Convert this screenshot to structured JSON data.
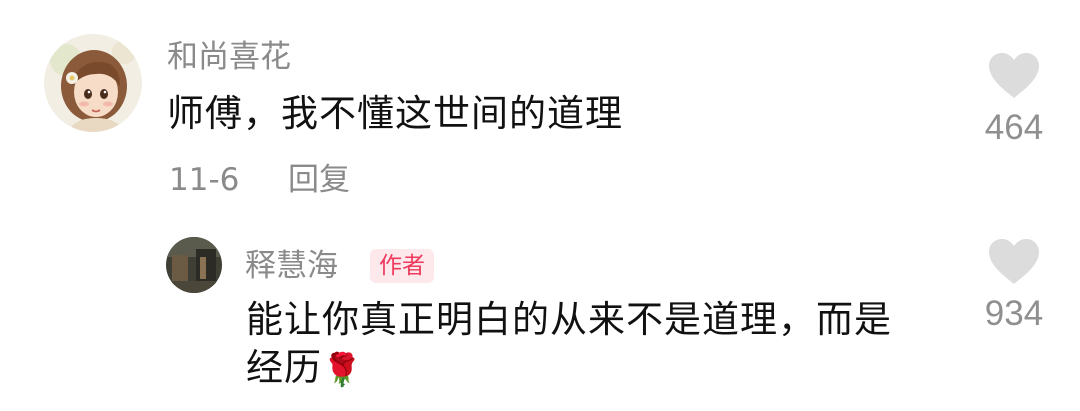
{
  "comment": {
    "username": "和尚喜花",
    "text": "师傅，我不懂这世间的道理",
    "date": "11-6",
    "reply_label": "回复",
    "likes": "464",
    "avatar_icon": "avatar-girl-illustration-icon"
  },
  "reply": {
    "username": "释慧海",
    "badge": "作者",
    "text": "能让你真正明白的从来不是道理，而是经历",
    "emoji": "🌹",
    "likes": "934",
    "avatar_icon": "avatar-dark-photo-icon"
  },
  "icons": {
    "like": "heart-icon"
  },
  "colors": {
    "badge_bg": "#fde8ec",
    "badge_text": "#ef3a5d",
    "meta_gray": "#8a8a8a",
    "heart_gray": "#dcdcdc"
  }
}
